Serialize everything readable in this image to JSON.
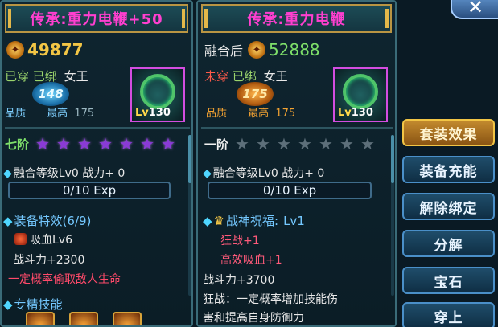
{
  "left": {
    "title": "传承:重力电鞭+50",
    "power_icon": "🪙",
    "power_value": "49877",
    "status": {
      "worn": "已穿",
      "bound": "已绑",
      "name": "女王"
    },
    "badge_value": "148",
    "quality_label": "品质",
    "max_label": "最高",
    "max_value": "175",
    "item": {
      "lv_prefix": "Lv",
      "lv_value": "130"
    },
    "stage_label": "七阶",
    "stars": [
      "★",
      "★",
      "★",
      "★",
      "★",
      "★",
      "★"
    ],
    "fuse_line": "融合等级Lv0 战力+ 0",
    "exp_text": "0/10 Exp",
    "effects_title": "装备特效(6/9)",
    "skill_name": "吸血Lv6",
    "combat_line": "战斗力+2300",
    "effect_desc": "一定概率偷取敌人生命",
    "specialty_title": "专精技能"
  },
  "right": {
    "title": "传承:重力电鞭",
    "fuse_prefix": "融合后",
    "power_icon": "🪙",
    "power_value": "52888",
    "status": {
      "worn": "未穿",
      "bound": "已绑",
      "name": "女王"
    },
    "badge_value": "175",
    "quality_label": "品质",
    "max_label": "最高",
    "max_value": "175",
    "item": {
      "lv_prefix": "Lv",
      "lv_value": "130"
    },
    "stage_label": "一阶",
    "stars": [
      "★",
      "★",
      "★",
      "★",
      "★",
      "★",
      "★"
    ],
    "fuse_line": "融合等级Lv0 战力+ 0",
    "exp_text": "0/10 Exp",
    "bless_title": "战神祝福:",
    "bless_level": "Lv1",
    "bless_line1": "狂战+1",
    "bless_line2": "高效吸血+1",
    "combat_line": "战斗力+3700",
    "desc_line1": "狂战：一定概率增加技能伤",
    "desc_line2": "害和提高自身防御力"
  },
  "buttons": {
    "set_effect": "套装效果",
    "recharge": "装备充能",
    "unbind": "解除绑定",
    "decompose": "分解",
    "gem": "宝石",
    "equip": "穿上"
  },
  "close_icon": "✕"
}
